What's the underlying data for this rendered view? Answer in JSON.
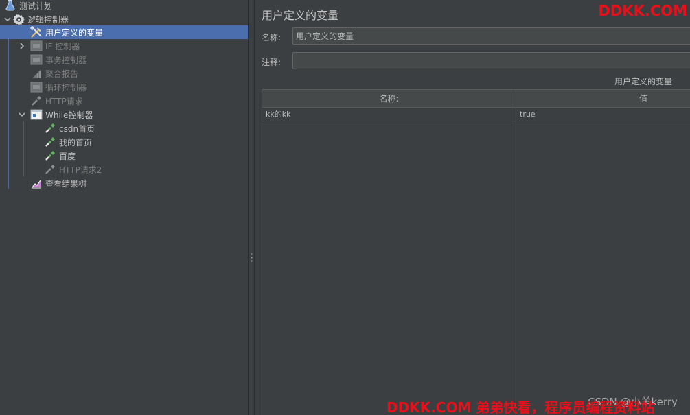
{
  "tree": {
    "root": {
      "label": "测试计划",
      "icon": "flask-icon"
    },
    "controller": {
      "label": "逻辑控制器",
      "icon": "gear-icon",
      "expanded": true
    },
    "items": [
      {
        "label": "用户定义的变量",
        "icon": "tools-icon",
        "selected": true,
        "enabled": true
      },
      {
        "label": "IF 控制器",
        "icon": "controller-icon",
        "enabled": false,
        "collapsed": true
      },
      {
        "label": "事务控制器",
        "icon": "controller-icon",
        "enabled": false
      },
      {
        "label": "聚合报告",
        "icon": "bar-chart-icon",
        "enabled": false
      },
      {
        "label": "循环控制器",
        "icon": "controller-icon",
        "enabled": false
      },
      {
        "label": "HTTP请求",
        "icon": "pipette-icon",
        "enabled": false
      }
    ],
    "while": {
      "label": "While控制器",
      "icon": "while-controller-icon",
      "children": [
        {
          "label": "csdn首页",
          "icon": "pipette-icon",
          "enabled": true
        },
        {
          "label": "我的首页",
          "icon": "pipette-icon",
          "enabled": true
        },
        {
          "label": "百度",
          "icon": "pipette-icon",
          "enabled": true
        },
        {
          "label": "HTTP请求2",
          "icon": "pipette-icon",
          "enabled": false
        }
      ]
    },
    "result_tree": {
      "label": "查看结果树",
      "icon": "result-tree-icon"
    }
  },
  "panel": {
    "title": "用户定义的变量",
    "name_label": "名称:",
    "name_value": "用户定义的变量",
    "comment_label": "注释:",
    "comment_value": "",
    "table_caption": "用户定义的变量",
    "columns": [
      "名称:",
      "值"
    ],
    "rows": [
      {
        "name": "kk的kk",
        "value": "true"
      }
    ]
  },
  "watermarks": {
    "top": "DDKK.COM",
    "bottom": "DDKK.COM 弟弟快看，程序员编程资料站",
    "csdn": "CSDN @小羊kerry"
  },
  "colors": {
    "background": "#3c3f41",
    "selection": "#4b6eaf",
    "watermark": "#e8101a",
    "pipette_enabled": "#5fb35a"
  }
}
